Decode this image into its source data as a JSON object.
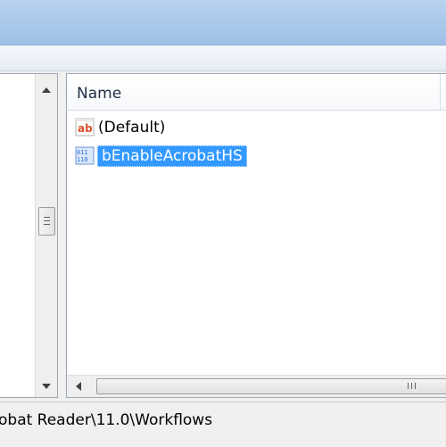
{
  "list": {
    "column_name": "Name",
    "values": [
      {
        "name": "(Default)",
        "icon": "string-value-icon",
        "selected": false
      },
      {
        "name": "bEnableAcrobatHS",
        "icon": "binary-value-icon",
        "selected": true
      }
    ]
  },
  "status": {
    "path": "obat Reader\\11.0\\Workflows"
  },
  "colors": {
    "selection": "#3399ff",
    "titlebar": "#a8c7ea",
    "string_icon": "#d9502a",
    "binary_icon": "#2f6fd6"
  }
}
